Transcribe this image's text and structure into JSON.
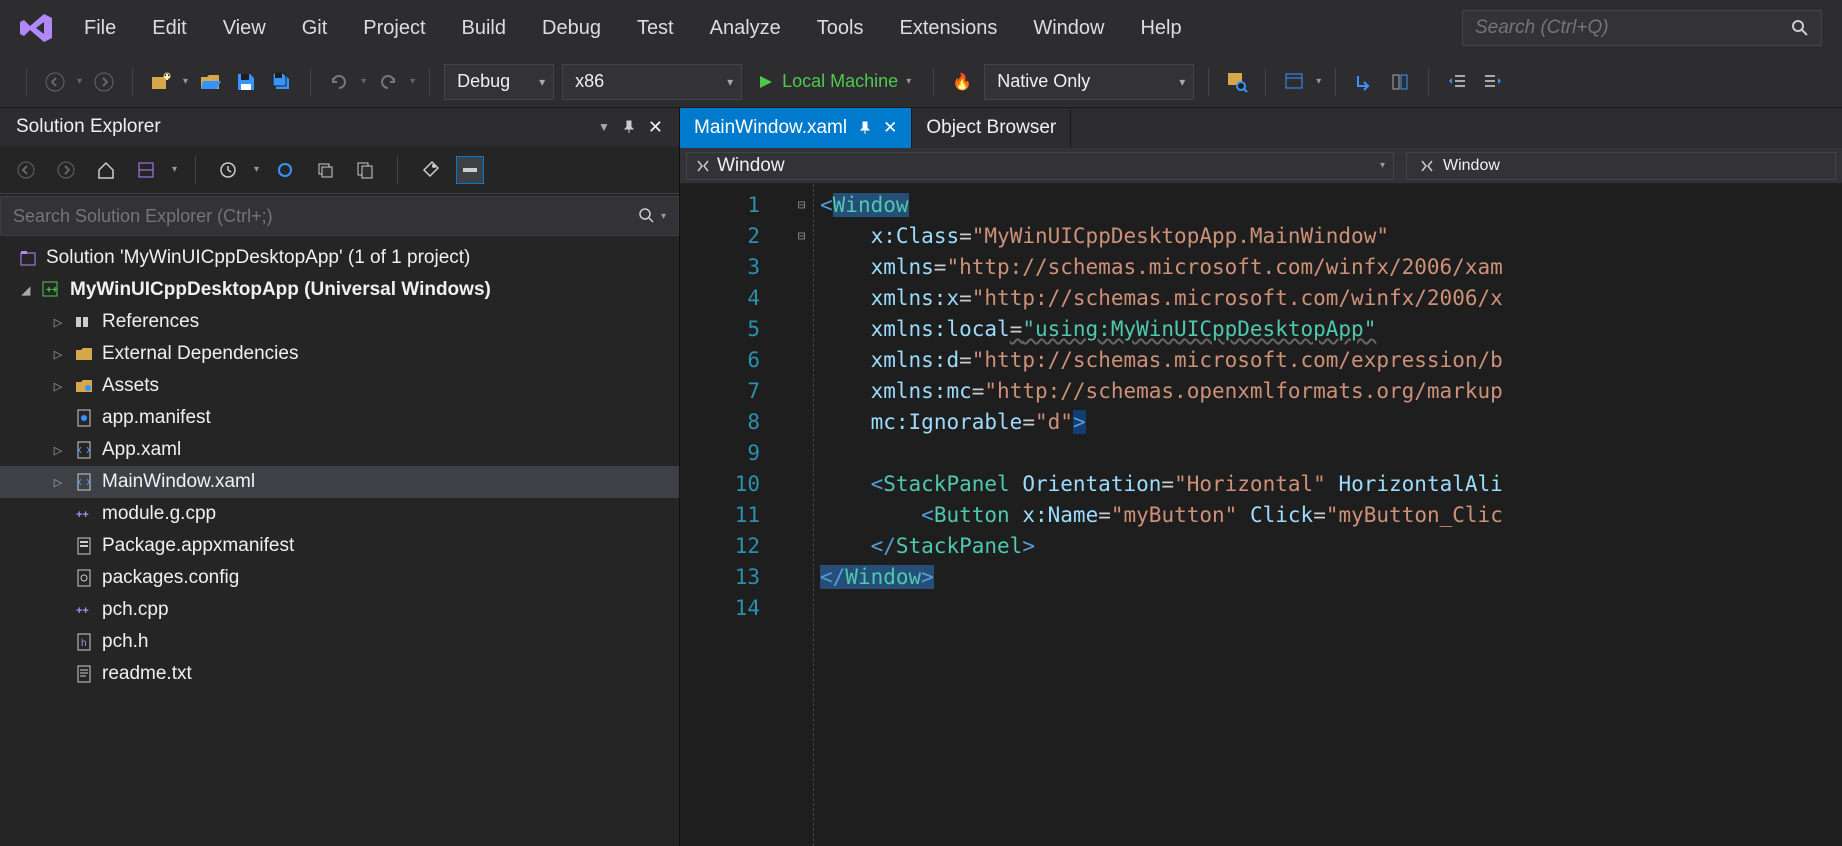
{
  "menubar": {
    "items": [
      "File",
      "Edit",
      "View",
      "Git",
      "Project",
      "Build",
      "Debug",
      "Test",
      "Analyze",
      "Tools",
      "Extensions",
      "Window",
      "Help"
    ],
    "search_placeholder": "Search (Ctrl+Q)"
  },
  "toolbar": {
    "config": "Debug",
    "platform": "x86",
    "target": "Local Machine",
    "debug_type": "Native Only"
  },
  "solution_explorer": {
    "title": "Solution Explorer",
    "search_placeholder": "Search Solution Explorer (Ctrl+;)",
    "root": "Solution 'MyWinUICppDesktopApp' (1 of 1 project)",
    "project": "MyWinUICppDesktopApp (Universal Windows)",
    "items": [
      {
        "label": "References",
        "icon": "references",
        "expandable": true
      },
      {
        "label": "External Dependencies",
        "icon": "folder-ext",
        "expandable": true
      },
      {
        "label": "Assets",
        "icon": "folder-assets",
        "expandable": true
      },
      {
        "label": "app.manifest",
        "icon": "file-xml",
        "expandable": false
      },
      {
        "label": "App.xaml",
        "icon": "file-xaml",
        "expandable": true
      },
      {
        "label": "MainWindow.xaml",
        "icon": "file-xaml",
        "expandable": true,
        "selected": true
      },
      {
        "label": "module.g.cpp",
        "icon": "file-cpp",
        "expandable": false
      },
      {
        "label": "Package.appxmanifest",
        "icon": "file-manifest",
        "expandable": false
      },
      {
        "label": "packages.config",
        "icon": "file-config",
        "expandable": false
      },
      {
        "label": "pch.cpp",
        "icon": "file-cpp",
        "expandable": false
      },
      {
        "label": "pch.h",
        "icon": "file-h",
        "expandable": false
      },
      {
        "label": "readme.txt",
        "icon": "file-txt",
        "expandable": false
      }
    ]
  },
  "editor": {
    "tabs": [
      {
        "label": "MainWindow.xaml",
        "active": true,
        "pinned": true
      },
      {
        "label": "Object Browser",
        "active": false
      }
    ],
    "breadcrumb_left": "Window",
    "breadcrumb_right": "Window",
    "code": {
      "lines": [
        {
          "n": 1,
          "fold": "⊟",
          "tokens": [
            {
              "t": "<",
              "c": "tag"
            },
            {
              "t": "Window",
              "c": "elem",
              "hl": true
            }
          ]
        },
        {
          "n": 2,
          "tokens": [
            {
              "t": "    ",
              "c": ""
            },
            {
              "t": "x",
              "c": "attr"
            },
            {
              "t": ":",
              "c": "attr"
            },
            {
              "t": "Class",
              "c": "attr"
            },
            {
              "t": "=",
              "c": "eq"
            },
            {
              "t": "\"MyWinUICppDesktopApp.MainWindow\"",
              "c": "str"
            }
          ]
        },
        {
          "n": 3,
          "tokens": [
            {
              "t": "    ",
              "c": ""
            },
            {
              "t": "xmlns",
              "c": "attr"
            },
            {
              "t": "=",
              "c": "eq"
            },
            {
              "t": "\"http://schemas.microsoft.com/winfx/2006/xam",
              "c": "str"
            }
          ]
        },
        {
          "n": 4,
          "tokens": [
            {
              "t": "    ",
              "c": ""
            },
            {
              "t": "xmlns",
              "c": "attr"
            },
            {
              "t": ":",
              "c": "attr"
            },
            {
              "t": "x",
              "c": "attr"
            },
            {
              "t": "=",
              "c": "eq"
            },
            {
              "t": "\"http://schemas.microsoft.com/winfx/2006/x",
              "c": "str"
            }
          ]
        },
        {
          "n": 5,
          "tokens": [
            {
              "t": "    ",
              "c": ""
            },
            {
              "t": "xmlns",
              "c": "attr"
            },
            {
              "t": ":",
              "c": "attr"
            },
            {
              "t": "local",
              "c": "attr"
            },
            {
              "t": "=",
              "c": "eq",
              "ul": true
            },
            {
              "t": "\"using:MyWinUICppDesktopApp\"",
              "c": "local",
              "ul": true
            }
          ]
        },
        {
          "n": 6,
          "tokens": [
            {
              "t": "    ",
              "c": ""
            },
            {
              "t": "xmlns",
              "c": "attr"
            },
            {
              "t": ":",
              "c": "attr"
            },
            {
              "t": "d",
              "c": "attr"
            },
            {
              "t": "=",
              "c": "eq"
            },
            {
              "t": "\"http://schemas.microsoft.com/expression/b",
              "c": "str"
            }
          ]
        },
        {
          "n": 7,
          "tokens": [
            {
              "t": "    ",
              "c": ""
            },
            {
              "t": "xmlns",
              "c": "attr"
            },
            {
              "t": ":",
              "c": "attr"
            },
            {
              "t": "mc",
              "c": "attr"
            },
            {
              "t": "=",
              "c": "eq"
            },
            {
              "t": "\"http://schemas.openxmlformats.org/markup",
              "c": "str"
            }
          ]
        },
        {
          "n": 8,
          "tokens": [
            {
              "t": "    ",
              "c": ""
            },
            {
              "t": "mc",
              "c": "attr"
            },
            {
              "t": ":",
              "c": "attr"
            },
            {
              "t": "Ignorable",
              "c": "attr"
            },
            {
              "t": "=",
              "c": "eq"
            },
            {
              "t": "\"d\"",
              "c": "str"
            },
            {
              "t": ">",
              "c": "tag",
              "hl2": true
            }
          ]
        },
        {
          "n": 9,
          "tokens": []
        },
        {
          "n": 10,
          "fold": "⊟",
          "tokens": [
            {
              "t": "    ",
              "c": ""
            },
            {
              "t": "<",
              "c": "tag"
            },
            {
              "t": "StackPanel",
              "c": "elem"
            },
            {
              "t": " ",
              "c": ""
            },
            {
              "t": "Orientation",
              "c": "attr"
            },
            {
              "t": "=",
              "c": "eq"
            },
            {
              "t": "\"Horizontal\"",
              "c": "str"
            },
            {
              "t": " ",
              "c": ""
            },
            {
              "t": "HorizontalAli",
              "c": "attr"
            }
          ]
        },
        {
          "n": 11,
          "tokens": [
            {
              "t": "        ",
              "c": ""
            },
            {
              "t": "<",
              "c": "tag"
            },
            {
              "t": "Button",
              "c": "elem"
            },
            {
              "t": " ",
              "c": ""
            },
            {
              "t": "x",
              "c": "attr"
            },
            {
              "t": ":",
              "c": "attr"
            },
            {
              "t": "Name",
              "c": "attr"
            },
            {
              "t": "=",
              "c": "eq"
            },
            {
              "t": "\"myButton\"",
              "c": "str"
            },
            {
              "t": " ",
              "c": ""
            },
            {
              "t": "Click",
              "c": "attr"
            },
            {
              "t": "=",
              "c": "eq"
            },
            {
              "t": "\"myButton_Clic",
              "c": "str"
            }
          ]
        },
        {
          "n": 12,
          "tokens": [
            {
              "t": "    ",
              "c": ""
            },
            {
              "t": "</",
              "c": "tag"
            },
            {
              "t": "StackPanel",
              "c": "elem"
            },
            {
              "t": ">",
              "c": "tag"
            }
          ]
        },
        {
          "n": 13,
          "tokens": [
            {
              "t": "</",
              "c": "tag",
              "hl": true
            },
            {
              "t": "Window",
              "c": "elem",
              "hl": true
            },
            {
              "t": ">",
              "c": "tag",
              "hl": true
            }
          ]
        },
        {
          "n": 14,
          "tokens": []
        }
      ]
    }
  }
}
